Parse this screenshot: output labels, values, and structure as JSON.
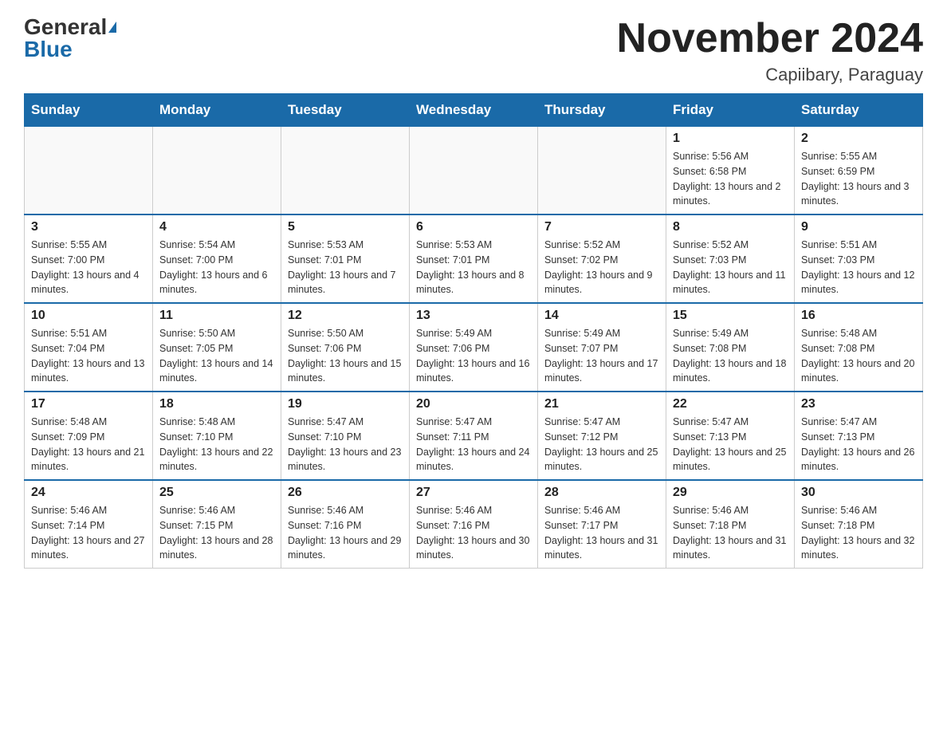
{
  "header": {
    "logo_general": "General",
    "logo_blue": "Blue",
    "month_title": "November 2024",
    "location": "Capiibary, Paraguay"
  },
  "weekdays": [
    "Sunday",
    "Monday",
    "Tuesday",
    "Wednesday",
    "Thursday",
    "Friday",
    "Saturday"
  ],
  "weeks": [
    [
      {
        "day": "",
        "sunrise": "",
        "sunset": "",
        "daylight": ""
      },
      {
        "day": "",
        "sunrise": "",
        "sunset": "",
        "daylight": ""
      },
      {
        "day": "",
        "sunrise": "",
        "sunset": "",
        "daylight": ""
      },
      {
        "day": "",
        "sunrise": "",
        "sunset": "",
        "daylight": ""
      },
      {
        "day": "",
        "sunrise": "",
        "sunset": "",
        "daylight": ""
      },
      {
        "day": "1",
        "sunrise": "Sunrise: 5:56 AM",
        "sunset": "Sunset: 6:58 PM",
        "daylight": "Daylight: 13 hours and 2 minutes."
      },
      {
        "day": "2",
        "sunrise": "Sunrise: 5:55 AM",
        "sunset": "Sunset: 6:59 PM",
        "daylight": "Daylight: 13 hours and 3 minutes."
      }
    ],
    [
      {
        "day": "3",
        "sunrise": "Sunrise: 5:55 AM",
        "sunset": "Sunset: 7:00 PM",
        "daylight": "Daylight: 13 hours and 4 minutes."
      },
      {
        "day": "4",
        "sunrise": "Sunrise: 5:54 AM",
        "sunset": "Sunset: 7:00 PM",
        "daylight": "Daylight: 13 hours and 6 minutes."
      },
      {
        "day": "5",
        "sunrise": "Sunrise: 5:53 AM",
        "sunset": "Sunset: 7:01 PM",
        "daylight": "Daylight: 13 hours and 7 minutes."
      },
      {
        "day": "6",
        "sunrise": "Sunrise: 5:53 AM",
        "sunset": "Sunset: 7:01 PM",
        "daylight": "Daylight: 13 hours and 8 minutes."
      },
      {
        "day": "7",
        "sunrise": "Sunrise: 5:52 AM",
        "sunset": "Sunset: 7:02 PM",
        "daylight": "Daylight: 13 hours and 9 minutes."
      },
      {
        "day": "8",
        "sunrise": "Sunrise: 5:52 AM",
        "sunset": "Sunset: 7:03 PM",
        "daylight": "Daylight: 13 hours and 11 minutes."
      },
      {
        "day": "9",
        "sunrise": "Sunrise: 5:51 AM",
        "sunset": "Sunset: 7:03 PM",
        "daylight": "Daylight: 13 hours and 12 minutes."
      }
    ],
    [
      {
        "day": "10",
        "sunrise": "Sunrise: 5:51 AM",
        "sunset": "Sunset: 7:04 PM",
        "daylight": "Daylight: 13 hours and 13 minutes."
      },
      {
        "day": "11",
        "sunrise": "Sunrise: 5:50 AM",
        "sunset": "Sunset: 7:05 PM",
        "daylight": "Daylight: 13 hours and 14 minutes."
      },
      {
        "day": "12",
        "sunrise": "Sunrise: 5:50 AM",
        "sunset": "Sunset: 7:06 PM",
        "daylight": "Daylight: 13 hours and 15 minutes."
      },
      {
        "day": "13",
        "sunrise": "Sunrise: 5:49 AM",
        "sunset": "Sunset: 7:06 PM",
        "daylight": "Daylight: 13 hours and 16 minutes."
      },
      {
        "day": "14",
        "sunrise": "Sunrise: 5:49 AM",
        "sunset": "Sunset: 7:07 PM",
        "daylight": "Daylight: 13 hours and 17 minutes."
      },
      {
        "day": "15",
        "sunrise": "Sunrise: 5:49 AM",
        "sunset": "Sunset: 7:08 PM",
        "daylight": "Daylight: 13 hours and 18 minutes."
      },
      {
        "day": "16",
        "sunrise": "Sunrise: 5:48 AM",
        "sunset": "Sunset: 7:08 PM",
        "daylight": "Daylight: 13 hours and 20 minutes."
      }
    ],
    [
      {
        "day": "17",
        "sunrise": "Sunrise: 5:48 AM",
        "sunset": "Sunset: 7:09 PM",
        "daylight": "Daylight: 13 hours and 21 minutes."
      },
      {
        "day": "18",
        "sunrise": "Sunrise: 5:48 AM",
        "sunset": "Sunset: 7:10 PM",
        "daylight": "Daylight: 13 hours and 22 minutes."
      },
      {
        "day": "19",
        "sunrise": "Sunrise: 5:47 AM",
        "sunset": "Sunset: 7:10 PM",
        "daylight": "Daylight: 13 hours and 23 minutes."
      },
      {
        "day": "20",
        "sunrise": "Sunrise: 5:47 AM",
        "sunset": "Sunset: 7:11 PM",
        "daylight": "Daylight: 13 hours and 24 minutes."
      },
      {
        "day": "21",
        "sunrise": "Sunrise: 5:47 AM",
        "sunset": "Sunset: 7:12 PM",
        "daylight": "Daylight: 13 hours and 25 minutes."
      },
      {
        "day": "22",
        "sunrise": "Sunrise: 5:47 AM",
        "sunset": "Sunset: 7:13 PM",
        "daylight": "Daylight: 13 hours and 25 minutes."
      },
      {
        "day": "23",
        "sunrise": "Sunrise: 5:47 AM",
        "sunset": "Sunset: 7:13 PM",
        "daylight": "Daylight: 13 hours and 26 minutes."
      }
    ],
    [
      {
        "day": "24",
        "sunrise": "Sunrise: 5:46 AM",
        "sunset": "Sunset: 7:14 PM",
        "daylight": "Daylight: 13 hours and 27 minutes."
      },
      {
        "day": "25",
        "sunrise": "Sunrise: 5:46 AM",
        "sunset": "Sunset: 7:15 PM",
        "daylight": "Daylight: 13 hours and 28 minutes."
      },
      {
        "day": "26",
        "sunrise": "Sunrise: 5:46 AM",
        "sunset": "Sunset: 7:16 PM",
        "daylight": "Daylight: 13 hours and 29 minutes."
      },
      {
        "day": "27",
        "sunrise": "Sunrise: 5:46 AM",
        "sunset": "Sunset: 7:16 PM",
        "daylight": "Daylight: 13 hours and 30 minutes."
      },
      {
        "day": "28",
        "sunrise": "Sunrise: 5:46 AM",
        "sunset": "Sunset: 7:17 PM",
        "daylight": "Daylight: 13 hours and 31 minutes."
      },
      {
        "day": "29",
        "sunrise": "Sunrise: 5:46 AM",
        "sunset": "Sunset: 7:18 PM",
        "daylight": "Daylight: 13 hours and 31 minutes."
      },
      {
        "day": "30",
        "sunrise": "Sunrise: 5:46 AM",
        "sunset": "Sunset: 7:18 PM",
        "daylight": "Daylight: 13 hours and 32 minutes."
      }
    ]
  ]
}
